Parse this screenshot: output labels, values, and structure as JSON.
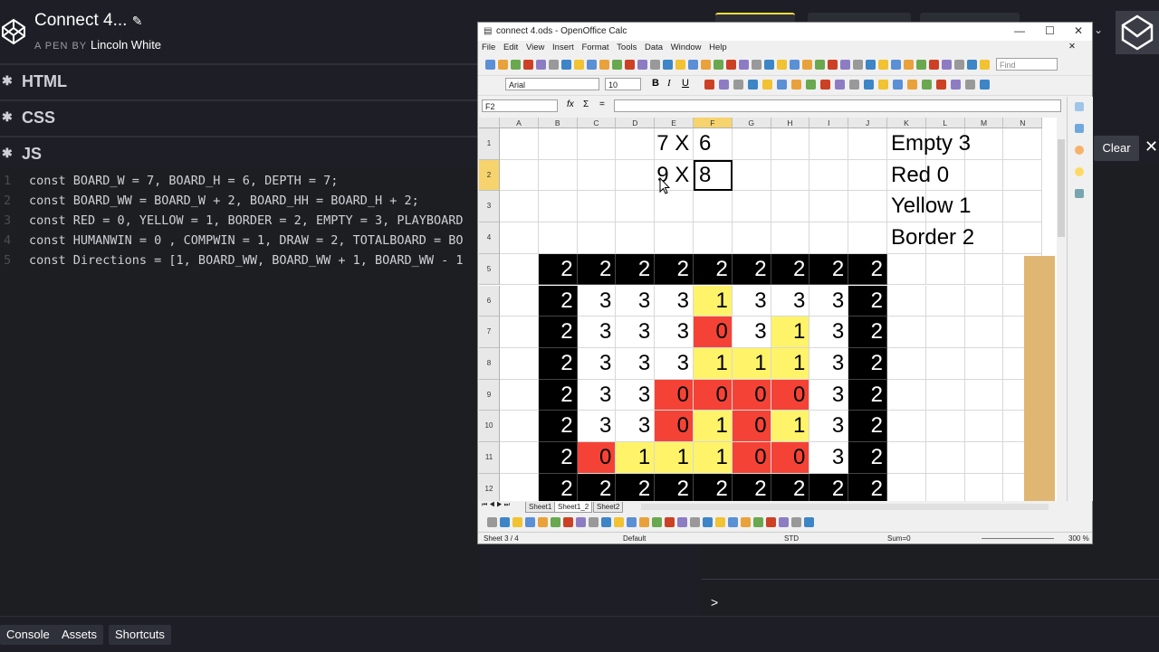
{
  "codepen": {
    "title": "Connect 4...",
    "edit_icon": "pencil-icon",
    "byline_prefix": "A PEN BY",
    "author": "Lincoln White",
    "panes": [
      {
        "label": "HTML"
      },
      {
        "label": "CSS"
      },
      {
        "label": "JS"
      }
    ],
    "code_lines": [
      {
        "n": "1",
        "text": "const BOARD_W = 7, BOARD_H = 6, DEPTH = 7;"
      },
      {
        "n": "2",
        "text": "const BOARD_WW = BOARD_W + 2, BOARD_HH = BOARD_H + 2;"
      },
      {
        "n": "3",
        "text": "const RED = 0, YELLOW = 1, BORDER = 2, EMPTY = 3, PLAYBOARD"
      },
      {
        "n": "4",
        "text": "const HUMANWIN = 0 , COMPWIN = 1, DRAW = 2, TOTALBOARD = BO"
      },
      {
        "n": "5",
        "text": "const Directions = [1, BOARD_WW, BOARD_WW + 1, BOARD_WW - 1"
      }
    ],
    "clear_label": "Clear",
    "console_prompt": ">",
    "bottom_buttons": [
      "Console",
      "Assets",
      "Shortcuts"
    ]
  },
  "calc": {
    "window_title": "connect 4.ods - OpenOffice Calc",
    "menu": [
      "File",
      "Edit",
      "View",
      "Insert",
      "Format",
      "Tools",
      "Data",
      "Window",
      "Help"
    ],
    "find_placeholder": "Find",
    "font_name": "Arial",
    "font_size": "10",
    "cell_ref": "F2",
    "formula_icons": [
      "fx",
      "Σ",
      "="
    ],
    "columns": [
      "A",
      "B",
      "C",
      "D",
      "E",
      "F",
      "G",
      "H",
      "I",
      "J",
      "K",
      "L",
      "M",
      "N"
    ],
    "selected_column": "F",
    "rows": [
      "1",
      "2",
      "3",
      "4",
      "5",
      "6",
      "7",
      "8",
      "9",
      "10",
      "11",
      "12"
    ],
    "selected_row": "2",
    "dims": [
      {
        "a": "7",
        "x": "X",
        "b": "6"
      },
      {
        "a": "9",
        "x": "X",
        "b": "8"
      }
    ],
    "legend": [
      "Empty 3",
      "Red 0",
      "Yellow 1",
      "Border 2"
    ],
    "board": [
      [
        "2",
        "2",
        "2",
        "2",
        "2",
        "2",
        "2",
        "2",
        "2"
      ],
      [
        "2",
        "3",
        "3",
        "3",
        "1",
        "3",
        "3",
        "3",
        "2"
      ],
      [
        "2",
        "3",
        "3",
        "3",
        "0",
        "3",
        "1",
        "3",
        "2"
      ],
      [
        "2",
        "3",
        "3",
        "3",
        "1",
        "1",
        "1",
        "3",
        "2"
      ],
      [
        "2",
        "3",
        "3",
        "0",
        "0",
        "0",
        "0",
        "3",
        "2"
      ],
      [
        "2",
        "3",
        "3",
        "0",
        "1",
        "0",
        "1",
        "3",
        "2"
      ],
      [
        "2",
        "0",
        "1",
        "1",
        "1",
        "0",
        "0",
        "3",
        "2"
      ],
      [
        "2",
        "2",
        "2",
        "2",
        "2",
        "2",
        "2",
        "2",
        "2"
      ]
    ],
    "board_colors": {
      "border": "#000000",
      "red": "#f44336",
      "yellow": "#fff36a",
      "empty": "#ffffff"
    },
    "sheet_tabs": [
      "Sheet1",
      "Sheet1_2",
      "Sheet2"
    ],
    "active_sheet": "Sheet1_2",
    "status": {
      "sheet": "Sheet 3 / 4",
      "style": "Default",
      "mode": "STD",
      "sum": "Sum=0",
      "zoom": "300 %"
    }
  }
}
